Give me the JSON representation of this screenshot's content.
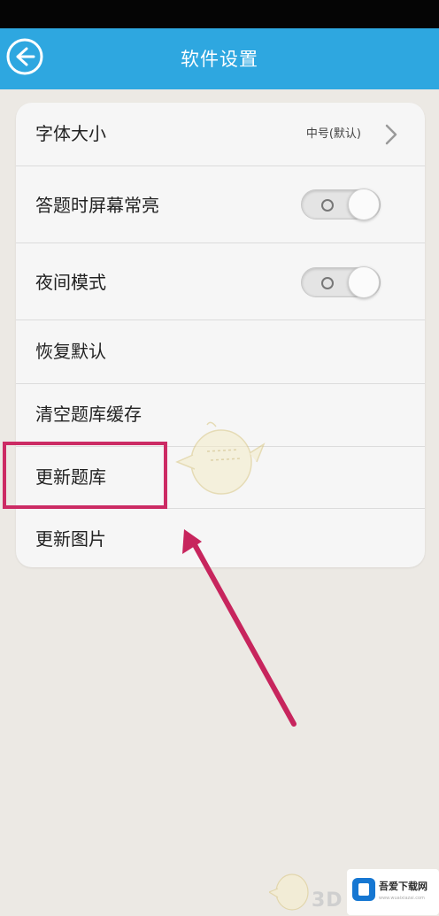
{
  "header": {
    "title": "软件设置",
    "back_icon": "back-arrow-icon"
  },
  "colors": {
    "header_bg": "#2ea7e0",
    "highlight": "#cc2b64"
  },
  "settings": {
    "font_size": {
      "label": "字体大小",
      "value": "中号(默认)"
    },
    "keep_screen_on": {
      "label": "答题时屏幕常亮",
      "toggle_state": "off"
    },
    "night_mode": {
      "label": "夜间模式",
      "toggle_state": "off"
    },
    "restore_default": {
      "label": "恢复默认"
    },
    "clear_cache": {
      "label": "清空题库缓存"
    },
    "update_question_bank": {
      "label": "更新题库"
    },
    "update_images": {
      "label": "更新图片"
    }
  },
  "watermark": {
    "site_name": "吾爱下载网",
    "url": "www.wuaixiazai.com",
    "brand": "3D"
  }
}
